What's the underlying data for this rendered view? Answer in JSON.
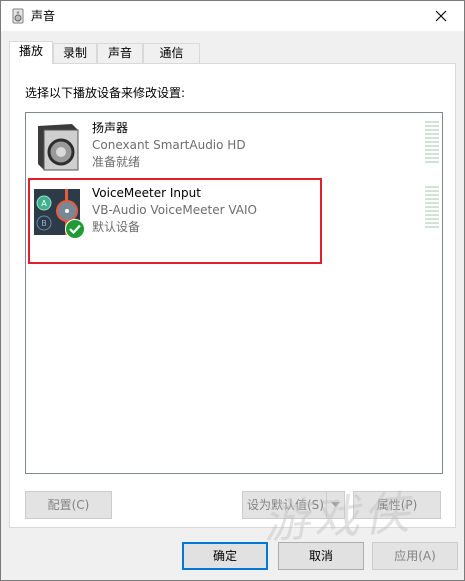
{
  "window": {
    "title": "声音"
  },
  "tabs": [
    {
      "label": "播放",
      "active": true
    },
    {
      "label": "录制",
      "active": false
    },
    {
      "label": "声音",
      "active": false
    },
    {
      "label": "通信",
      "active": false
    }
  ],
  "instruction": "选择以下播放设备来修改设置:",
  "devices": [
    {
      "name": "扬声器",
      "driver": "Conexant SmartAudio HD",
      "status": "准备就绪",
      "icon": "speaker-icon"
    },
    {
      "name": "VoiceMeeter Input",
      "driver": "VB-Audio VoiceMeeter VAIO",
      "status": "默认设备",
      "icon": "voicemeeter-icon",
      "default_badge": "green-checkmark-icon"
    }
  ],
  "device_buttons": {
    "configure": "配置(C)",
    "set_default": "设为默认值(S)",
    "properties": "属性(P)"
  },
  "dialog_buttons": {
    "ok": "确定",
    "cancel": "取消",
    "apply": "应用(A)"
  },
  "watermark": "游戏侠",
  "colors": {
    "highlight_border": "#e0202a",
    "focus_blue": "#0078d7",
    "check_green": "#1f9b35"
  }
}
